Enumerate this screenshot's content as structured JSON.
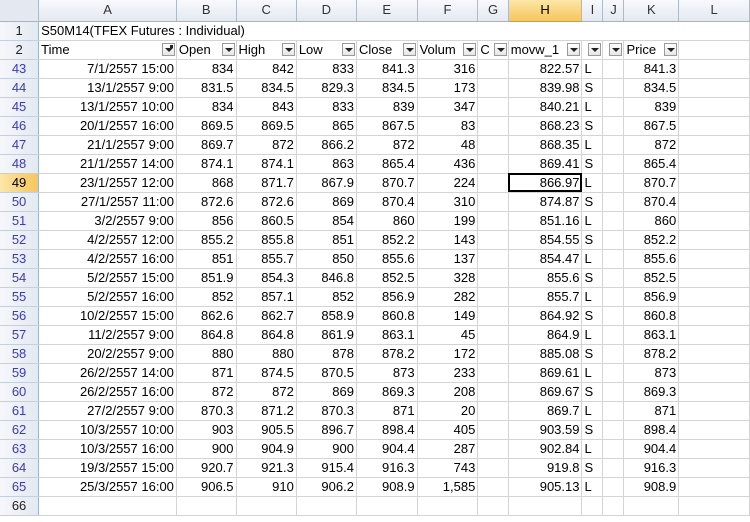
{
  "columns": [
    "A",
    "B",
    "C",
    "D",
    "E",
    "F",
    "G",
    "H",
    "I",
    "J",
    "K",
    "L"
  ],
  "row1": {
    "num": "1",
    "title": "S50M14(TFEX Futures : Individual)"
  },
  "row2": {
    "num": "2",
    "headers": [
      "Time",
      "Open",
      "High",
      "Low",
      "Close",
      "Volum",
      "C",
      "movw_1",
      "",
      "",
      "Price",
      ""
    ]
  },
  "rows": [
    {
      "n": "43",
      "a": "7/1/2557 15:00",
      "b": "834",
      "c": "842",
      "d": "833",
      "e": "841.3",
      "f": "316",
      "h": "822.57",
      "i": "L",
      "k": "841.3"
    },
    {
      "n": "44",
      "a": "13/1/2557 9:00",
      "b": "831.5",
      "c": "834.5",
      "d": "829.3",
      "e": "834.5",
      "f": "173",
      "h": "839.98",
      "i": "S",
      "k": "834.5"
    },
    {
      "n": "45",
      "a": "13/1/2557 10:00",
      "b": "834",
      "c": "843",
      "d": "833",
      "e": "839",
      "f": "347",
      "h": "840.21",
      "i": "L",
      "k": "839"
    },
    {
      "n": "46",
      "a": "20/1/2557 16:00",
      "b": "869.5",
      "c": "869.5",
      "d": "865",
      "e": "867.5",
      "f": "83",
      "h": "868.23",
      "i": "S",
      "k": "867.5"
    },
    {
      "n": "47",
      "a": "21/1/2557 9:00",
      "b": "869.7",
      "c": "872",
      "d": "866.2",
      "e": "872",
      "f": "48",
      "h": "868.35",
      "i": "L",
      "k": "872"
    },
    {
      "n": "48",
      "a": "21/1/2557 14:00",
      "b": "874.1",
      "c": "874.1",
      "d": "863",
      "e": "865.4",
      "f": "436",
      "h": "869.41",
      "i": "S",
      "k": "865.4"
    },
    {
      "n": "49",
      "a": "23/1/2557 12:00",
      "b": "868",
      "c": "871.7",
      "d": "867.9",
      "e": "870.7",
      "f": "224",
      "h": "866.97",
      "i": "L",
      "k": "870.7"
    },
    {
      "n": "50",
      "a": "27/1/2557 11:00",
      "b": "872.6",
      "c": "872.6",
      "d": "869",
      "e": "870.4",
      "f": "310",
      "h": "874.87",
      "i": "S",
      "k": "870.4"
    },
    {
      "n": "51",
      "a": "3/2/2557 9:00",
      "b": "856",
      "c": "860.5",
      "d": "854",
      "e": "860",
      "f": "199",
      "h": "851.16",
      "i": "L",
      "k": "860"
    },
    {
      "n": "52",
      "a": "4/2/2557 12:00",
      "b": "855.2",
      "c": "855.8",
      "d": "851",
      "e": "852.2",
      "f": "143",
      "h": "854.55",
      "i": "S",
      "k": "852.2"
    },
    {
      "n": "53",
      "a": "4/2/2557 16:00",
      "b": "851",
      "c": "855.7",
      "d": "850",
      "e": "855.6",
      "f": "137",
      "h": "854.47",
      "i": "L",
      "k": "855.6"
    },
    {
      "n": "54",
      "a": "5/2/2557 15:00",
      "b": "851.9",
      "c": "854.3",
      "d": "846.8",
      "e": "852.5",
      "f": "328",
      "h": "855.6",
      "i": "S",
      "k": "852.5"
    },
    {
      "n": "55",
      "a": "5/2/2557 16:00",
      "b": "852",
      "c": "857.1",
      "d": "852",
      "e": "856.9",
      "f": "282",
      "h": "855.7",
      "i": "L",
      "k": "856.9"
    },
    {
      "n": "56",
      "a": "10/2/2557 15:00",
      "b": "862.6",
      "c": "862.7",
      "d": "858.9",
      "e": "860.8",
      "f": "149",
      "h": "864.92",
      "i": "S",
      "k": "860.8"
    },
    {
      "n": "57",
      "a": "11/2/2557 9:00",
      "b": "864.8",
      "c": "864.8",
      "d": "861.9",
      "e": "863.1",
      "f": "45",
      "h": "864.9",
      "i": "L",
      "k": "863.1"
    },
    {
      "n": "58",
      "a": "20/2/2557 9:00",
      "b": "880",
      "c": "880",
      "d": "878",
      "e": "878.2",
      "f": "172",
      "h": "885.08",
      "i": "S",
      "k": "878.2"
    },
    {
      "n": "59",
      "a": "26/2/2557 14:00",
      "b": "871",
      "c": "874.5",
      "d": "870.5",
      "e": "873",
      "f": "233",
      "h": "869.61",
      "i": "L",
      "k": "873"
    },
    {
      "n": "60",
      "a": "26/2/2557 16:00",
      "b": "872",
      "c": "872",
      "d": "869",
      "e": "869.3",
      "f": "208",
      "h": "869.67",
      "i": "S",
      "k": "869.3"
    },
    {
      "n": "61",
      "a": "27/2/2557 9:00",
      "b": "870.3",
      "c": "871.2",
      "d": "870.3",
      "e": "871",
      "f": "20",
      "h": "869.7",
      "i": "L",
      "k": "871"
    },
    {
      "n": "62",
      "a": "10/3/2557 10:00",
      "b": "903",
      "c": "905.5",
      "d": "896.7",
      "e": "898.4",
      "f": "405",
      "h": "903.59",
      "i": "S",
      "k": "898.4"
    },
    {
      "n": "63",
      "a": "10/3/2557 16:00",
      "b": "900",
      "c": "904.9",
      "d": "900",
      "e": "904.4",
      "f": "287",
      "h": "902.84",
      "i": "L",
      "k": "904.4"
    },
    {
      "n": "64",
      "a": "19/3/2557 15:00",
      "b": "920.7",
      "c": "921.3",
      "d": "915.4",
      "e": "916.3",
      "f": "743",
      "h": "919.8",
      "i": "S",
      "k": "916.3"
    },
    {
      "n": "65",
      "a": "25/3/2557 16:00",
      "b": "906.5",
      "c": "910",
      "d": "906.2",
      "e": "908.9",
      "f": "1,585",
      "h": "905.13",
      "i": "L",
      "k": "908.9"
    }
  ],
  "last_row": "66",
  "selection": {
    "row": "49",
    "column": "H"
  }
}
